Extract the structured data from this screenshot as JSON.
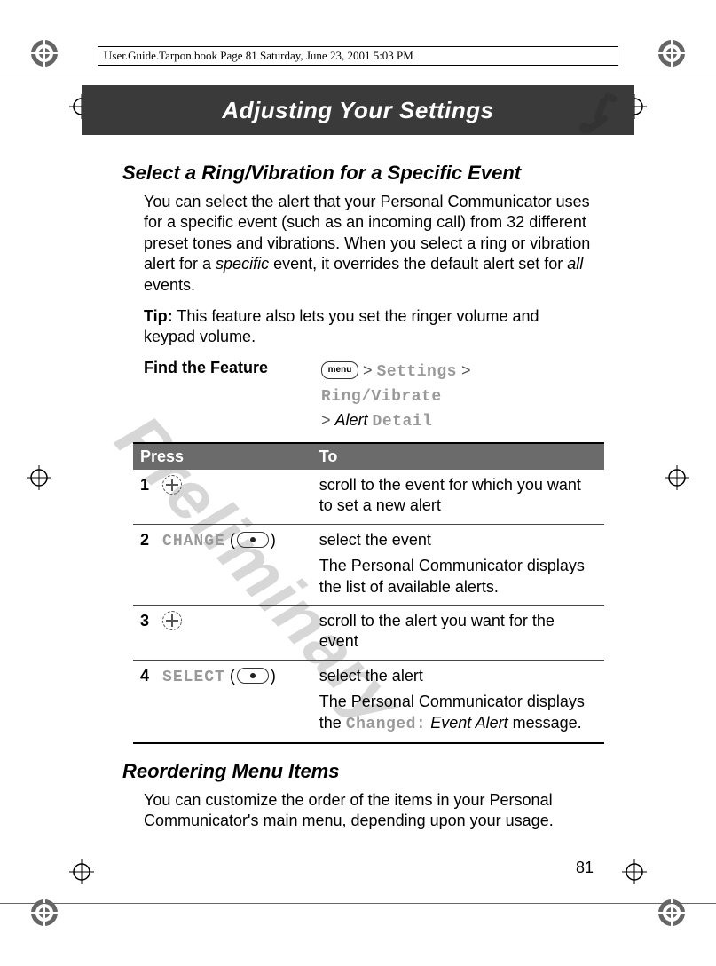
{
  "print_header": "User.Guide.Tarpon.book  Page 81  Saturday, June 23, 2001  5:03 PM",
  "chapter_title": "Adjusting Your Settings",
  "watermark": "Preliminary",
  "section1": {
    "title": "Select a Ring/Vibration for a Specific Event",
    "para1_a": "You can select the alert that your Personal Communicator uses for a specific event (such as an incoming call) from 32 different preset tones and vibrations. When you select a ring or vibration alert for a ",
    "para1_em1": "specific",
    "para1_b": " event, it overrides the default alert set for ",
    "para1_em2": "all",
    "para1_c": " events.",
    "tip_label": "Tip:",
    "tip_text": " This feature also lets you set the ringer volume and keypad volume.",
    "feature_label": "Find the Feature",
    "menu_key": "menu",
    "path_settings": "Settings",
    "path_ringvib": "Ring/Vibrate",
    "path_alert": "Alert",
    "path_detail": "Detail",
    "table": {
      "head_press": "Press",
      "head_to": "To",
      "rows": [
        {
          "num": "1",
          "press_kind": "nav",
          "to": "scroll to the event for which you want to set a new alert",
          "note": ""
        },
        {
          "num": "2",
          "press_kind": "soft",
          "press_label": "CHANGE",
          "to": "select the event",
          "note": "The Personal Communicator displays the list of available alerts."
        },
        {
          "num": "3",
          "press_kind": "nav",
          "to": "scroll to the alert you want for the event",
          "note": ""
        },
        {
          "num": "4",
          "press_kind": "soft",
          "press_label": "SELECT",
          "to": "select the alert",
          "note_a": "The Personal Communicator displays the ",
          "note_code": "Changed:",
          "note_em": " Event Alert",
          "note_b": " message."
        }
      ]
    }
  },
  "section2": {
    "title": "Reordering Menu Items",
    "para": "You can customize the order of the items in your Personal Communicator's main menu, depending upon your usage."
  },
  "page_number": "81"
}
